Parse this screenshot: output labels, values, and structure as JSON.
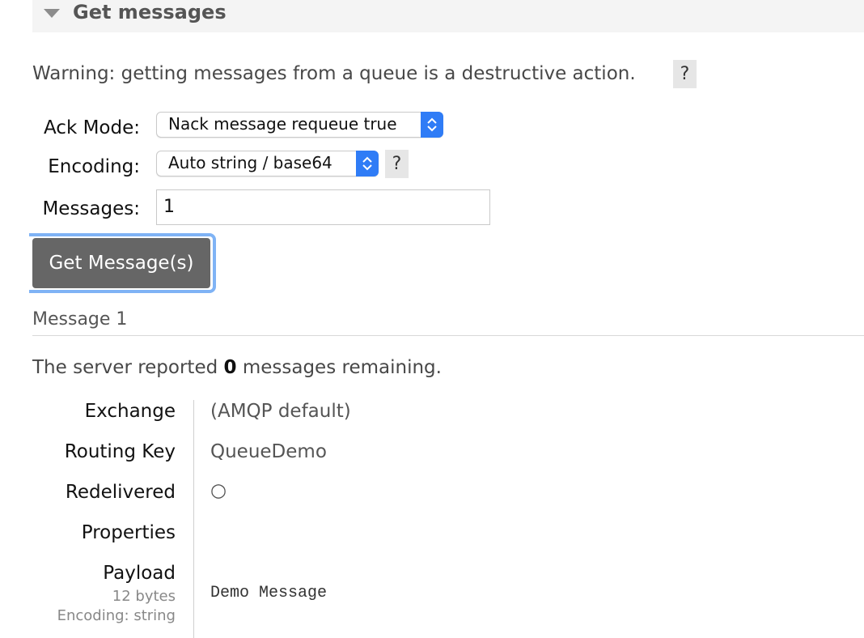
{
  "section": {
    "title": "Get messages"
  },
  "warning": {
    "text": "Warning: getting messages from a queue is a destructive action.",
    "help": "?"
  },
  "form": {
    "ack_mode_label": "Ack Mode:",
    "ack_mode_value": "Nack message requeue true",
    "encoding_label": "Encoding:",
    "encoding_value": "Auto string / base64",
    "encoding_help": "?",
    "messages_label": "Messages:",
    "messages_value": "1",
    "get_button": "Get Message(s)"
  },
  "result": {
    "heading": "Message 1",
    "server_prefix": "The server reported",
    "remaining_count": "0",
    "server_suffix": "messages remaining.",
    "rows": {
      "exchange_label": "Exchange",
      "exchange_value": "(AMQP default)",
      "routing_key_label": "Routing Key",
      "routing_key_value": "QueueDemo",
      "redelivered_label": "Redelivered",
      "redelivered_value": "○",
      "properties_label": "Properties",
      "payload_label": "Payload",
      "payload_size": "12 bytes",
      "payload_encoding": "Encoding: string",
      "payload_value": "Demo Message"
    }
  },
  "colors": {
    "accent": "#2f7cf6",
    "button": "#666666",
    "focus_ring": "#7fb3f5",
    "header_bg": "#f4f4f4"
  },
  "icons": {
    "collapse": "triangle-down-icon",
    "select_arrows": "chevron-up-down-icon"
  }
}
